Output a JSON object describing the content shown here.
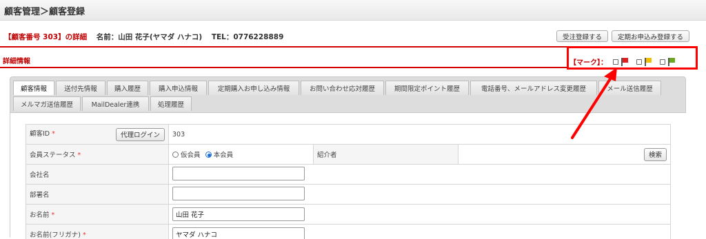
{
  "breadcrumb": "顧客管理＞顧客登録",
  "customer_header": {
    "id_text": "【顧客番号 303】の詳細",
    "name_text": "名前：山田 花子(ヤマダ ハナコ)",
    "tel_text": "TEL：0776228889"
  },
  "actions": {
    "order_register": "受注登録する",
    "subscription_register": "定期お申込み登録する"
  },
  "section_title": "詳細情報",
  "mark": {
    "label": "【マーク】：",
    "flags": [
      {
        "name": "red",
        "color": "#e02020"
      },
      {
        "name": "yellow",
        "color": "#f0c000"
      },
      {
        "name": "green",
        "color": "#6aa820"
      }
    ]
  },
  "tabs": {
    "row1": [
      "顧客情報",
      "送付先情報",
      "購入履歴",
      "購入申込情報",
      "定期購入お申し込み情報",
      "お問い合わせ応対履歴",
      "期間限定ポイント履歴",
      "電話番号、メールアドレス変更履歴",
      "メール送信履歴"
    ],
    "row2": [
      "メルマガ送信履歴",
      "MailDealer連携",
      "処理履歴"
    ]
  },
  "form": {
    "customer_id": {
      "label": "顧客ID",
      "required_mark": "*",
      "proxy_login": "代理ログイン",
      "value": "303"
    },
    "member_status": {
      "label": "会員ステータス",
      "required_mark": "*",
      "option_temp": "仮会員",
      "option_full": "本会員",
      "selected": "本会員"
    },
    "referrer": {
      "label": "紹介者",
      "search": "検索"
    },
    "company": {
      "label": "会社名",
      "value": ""
    },
    "department": {
      "label": "部署名",
      "value": ""
    },
    "name": {
      "label": "お名前",
      "required_mark": "*",
      "value": "山田 花子"
    },
    "name_kana": {
      "label": "お名前(フリガナ)",
      "required_mark": "*",
      "value": "ヤマダ ハナコ"
    }
  },
  "colors": {
    "accent_red": "#d40000",
    "annotation": "#ff0000"
  }
}
